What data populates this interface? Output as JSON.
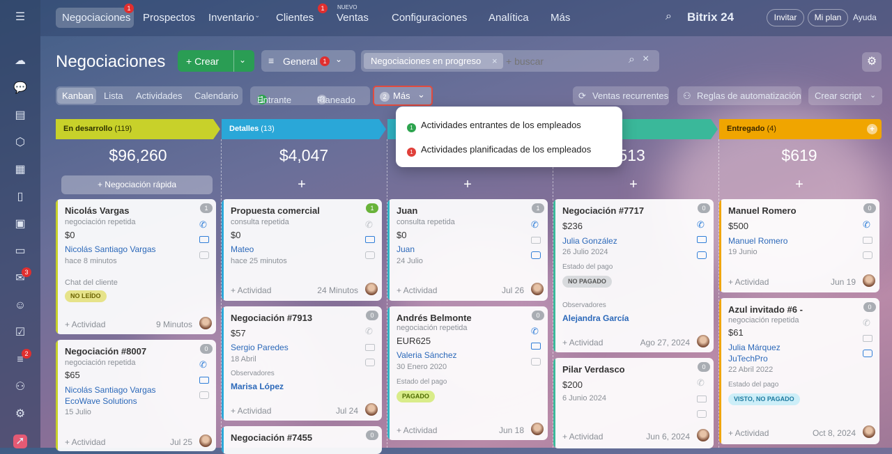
{
  "nav": {
    "items": [
      {
        "label": "Negociaciones",
        "badge": "1"
      },
      {
        "label": "Prospectos"
      },
      {
        "label": "Inventario"
      },
      {
        "label": "Clientes",
        "badge": "1"
      },
      {
        "label": "Ventas",
        "tag": "NUEVO"
      },
      {
        "label": "Configuraciones"
      },
      {
        "label": "Analítica"
      },
      {
        "label": "Más"
      }
    ],
    "brand": "Bitrix 24",
    "invite": "Invitar",
    "plan": "Mi plan",
    "help": "Ayuda"
  },
  "rail": {
    "mail_badge": "3",
    "filter_badge": "2"
  },
  "header": {
    "title": "Negociaciones",
    "create": "+ Crear",
    "general": "General",
    "general_badge": "1",
    "filter_chip": "Negociaciones en progreso",
    "search_placeholder": "+ buscar"
  },
  "views": {
    "kanban": "Kanban",
    "list": "Lista",
    "activities": "Actividades",
    "calendar": "Calendario",
    "incoming_count": "1",
    "incoming": "Entrante",
    "planned_count": "0",
    "planned": "Planeado",
    "more_count": "2",
    "more": "Más",
    "recurring": "Ventas recurrentes",
    "automation": "Reglas de automatización",
    "script": "Crear script"
  },
  "dropdown": [
    {
      "count": "",
      "label": "Actividades entrantes de los empleados",
      "color": "#2ea44f"
    },
    {
      "count": "",
      "label": "Actividades planificadas de los empleados",
      "color": "#e0403a"
    }
  ],
  "columns": [
    {
      "name": "En desarrollo",
      "count": "(119)",
      "sum": "$96,260",
      "color": "#c8d12a",
      "quick": "+ Negociación rápida"
    },
    {
      "name": "Detalles",
      "count": "(13)",
      "sum": "$4,047",
      "color": "#2aa7d8"
    },
    {
      "name": "",
      "count": "",
      "sum": "",
      "color": "#30b3c4"
    },
    {
      "name": "",
      "count": "",
      "sum": "0,513",
      "color": "#3ab89a"
    },
    {
      "name": "Entregado",
      "count": "(4)",
      "sum": "$619",
      "color": "#f0a500"
    }
  ],
  "cards": {
    "c1": {
      "title": "Nicolás Vargas",
      "count": "1",
      "sub": "negociación repetida",
      "value": "$0",
      "contact": "Nicolás Santiago Vargas",
      "time": "hace 8 minutos",
      "note": "Chat del cliente",
      "tag": "NO LEÍDO",
      "activity": "+ Actividad",
      "date": "9 Minutos"
    },
    "c2": {
      "title": "Negociación #8007",
      "count": "0",
      "sub": "negociación repetida",
      "value": "$65",
      "contact": "Nicolás Santiago Vargas",
      "company": "EcoWave Solutions",
      "time": "15 Julio",
      "activity": "+ Actividad",
      "date": "Jul 25"
    },
    "c3": {
      "title": "Propuesta comercial",
      "count": "1",
      "sub": "consulta repetida",
      "value": "$0",
      "contact": "Mateo",
      "time": "hace 25 minutos",
      "activity": "+ Actividad",
      "date": "24 Minutos"
    },
    "c4": {
      "title": "Negociación #7913",
      "count": "0",
      "value": "$57",
      "contact": "Sergio Paredes",
      "time": "18 Abril",
      "obs_label": "Observadores",
      "observer": "Marisa López",
      "activity": "+ Actividad",
      "date": "Jul 24"
    },
    "c5": {
      "title": "Negociación #7455",
      "count": "0"
    },
    "c6": {
      "title": "Juan",
      "count": "1",
      "sub": "consulta repetida",
      "value": "$0",
      "contact": "Juan",
      "time": "24 Julio",
      "activity": "+ Actividad",
      "date": "Jul 26"
    },
    "c7": {
      "title": "Andrés Belmonte",
      "count": "0",
      "sub": "negociación repetida",
      "value": "EUR625",
      "contact": "Valeria Sánchez",
      "time": "30 Enero 2020",
      "pay_label": "Estado del pago",
      "tag": "PAGADO",
      "activity": "+ Actividad",
      "date": "Jun 18"
    },
    "c8": {
      "title": "Negociación #7717",
      "count": "0",
      "value": "$236",
      "contact": "Julia González",
      "time": "26 Julio 2024",
      "pay_label": "Estado del pago",
      "tag": "NO PAGADO",
      "obs_label": "Observadores",
      "observer": "Alejandra García",
      "activity": "+ Actividad",
      "date": "Ago 27, 2024"
    },
    "c9": {
      "title": "Pilar Verdasco",
      "count": "0",
      "value": "$200",
      "time": "6 Junio 2024",
      "activity": "+ Actividad",
      "date": "Jun 6, 2024"
    },
    "c10": {
      "title": "Manuel Romero",
      "count": "0",
      "value": "$500",
      "contact": "Manuel Romero",
      "time": "19 Junio",
      "activity": "+ Actividad",
      "date": "Jun 19"
    },
    "c11": {
      "title": "Azul invitado #6 -",
      "count": "0",
      "sub": "negociación repetida",
      "value": "$61",
      "contact": "Julia Márquez",
      "company": "JuTechPro",
      "time": "22 Abril 2022",
      "pay_label": "Estado del pago",
      "tag": "VISTO, NO PAGADO",
      "activity": "+ Actividad",
      "date": "Oct 8, 2024"
    }
  }
}
